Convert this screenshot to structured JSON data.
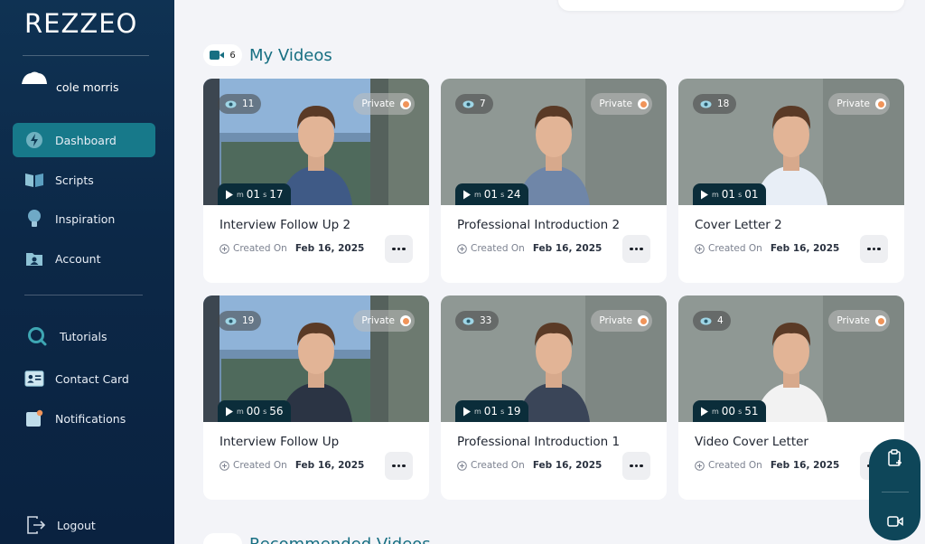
{
  "brand": {
    "logo": "REZZEO"
  },
  "user": {
    "name": "cole morris"
  },
  "nav": {
    "dashboard": "Dashboard",
    "scripts": "Scripts",
    "inspiration": "Inspiration",
    "account": "Account",
    "tutorials": "Tutorials",
    "contact_card": "Contact Card",
    "notifications": "Notifications",
    "logout": "Logout"
  },
  "my_videos": {
    "title": "My Videos",
    "count": "6",
    "videos": [
      {
        "title": "Interview Follow Up 2",
        "views": "11",
        "privacy": "Private",
        "min": "01",
        "sec": "17",
        "created_label": "Created On",
        "date": "Feb 16, 2025"
      },
      {
        "title": "Professional Introduction 2",
        "views": "7",
        "privacy": "Private",
        "min": "01",
        "sec": "24",
        "created_label": "Created On",
        "date": "Feb 16, 2025"
      },
      {
        "title": "Cover Letter 2",
        "views": "18",
        "privacy": "Private",
        "min": "01",
        "sec": "01",
        "created_label": "Created On",
        "date": "Feb 16, 2025"
      },
      {
        "title": "Interview Follow Up",
        "views": "19",
        "privacy": "Private",
        "min": "00",
        "sec": "56",
        "created_label": "Created On",
        "date": "Feb 16, 2025"
      },
      {
        "title": "Professional Introduction 1",
        "views": "33",
        "privacy": "Private",
        "min": "01",
        "sec": "19",
        "created_label": "Created On",
        "date": "Feb 16, 2025"
      },
      {
        "title": "Video Cover Letter",
        "views": "4",
        "privacy": "Private",
        "min": "00",
        "sec": "51",
        "created_label": "Created On",
        "date": "Feb 16, 2025"
      }
    ],
    "unit_min": "m",
    "unit_sec": "s"
  },
  "recommended": {
    "title": "Recommended Videos"
  },
  "colors": {
    "sidebar": "#0c2847",
    "accent": "#17798a",
    "title": "#176f82"
  }
}
